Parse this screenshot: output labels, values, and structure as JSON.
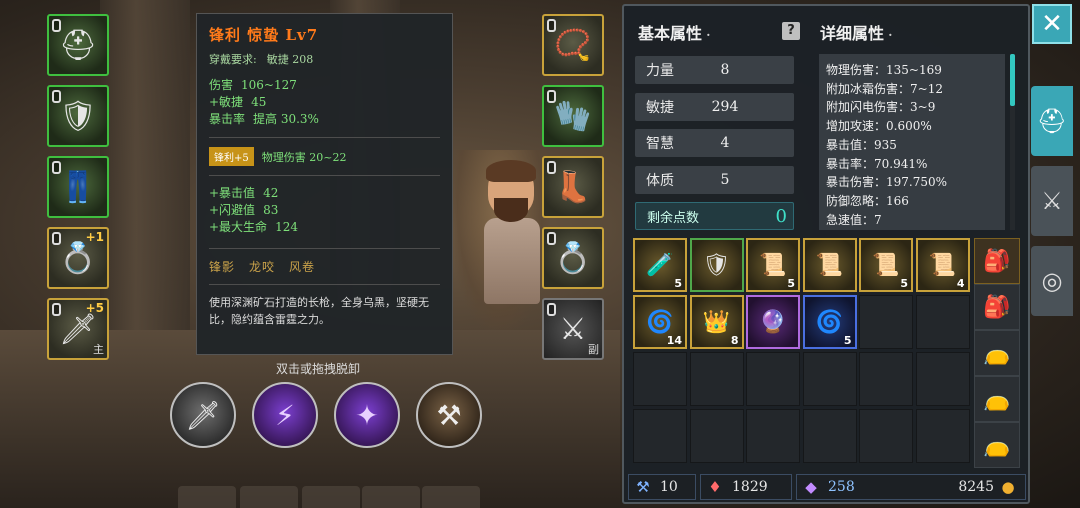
{
  "equipment_left": [
    {
      "name": "helmet",
      "border": "green",
      "icon": "helmet-icon",
      "glyph": "⛑"
    },
    {
      "name": "armor",
      "border": "green",
      "icon": "armor-icon",
      "glyph": "🛡"
    },
    {
      "name": "pants",
      "border": "green",
      "icon": "pants-icon",
      "glyph": "👖"
    },
    {
      "name": "ring",
      "border": "gold",
      "icon": "ring-icon",
      "glyph": "💍",
      "plus": "+1"
    },
    {
      "name": "spear",
      "border": "gold",
      "icon": "spear-icon",
      "glyph": "🗡",
      "plus": "+5",
      "tag": "主"
    }
  ],
  "equipment_right": [
    {
      "name": "necklace",
      "border": "gold",
      "icon": "necklace-icon",
      "glyph": "📿"
    },
    {
      "name": "gloves",
      "border": "green",
      "icon": "gloves-icon",
      "glyph": "🧤"
    },
    {
      "name": "boots",
      "border": "gold",
      "icon": "boots-icon",
      "glyph": "👢"
    },
    {
      "name": "ring2",
      "border": "gold",
      "icon": "ring-icon",
      "glyph": "💍"
    },
    {
      "name": "offhand",
      "border": "grey",
      "icon": "sword-icon",
      "glyph": "⚔",
      "tag": "副"
    }
  ],
  "tooltip": {
    "title": "锋利 惊蛰 Lv7",
    "req_label": "穿戴要求:",
    "req_value": "敏捷 208",
    "base_stats": [
      {
        "k": "伤害",
        "v": "106~127"
      },
      {
        "k": "+敏捷",
        "v": "45"
      },
      {
        "k": "暴击率",
        "v": "提高 30.3%"
      }
    ],
    "refine_badge": "锋利+5",
    "refine_text": "物理伤害 20~22",
    "extra_stats": [
      {
        "k": "+暴击值",
        "v": "42"
      },
      {
        "k": "+闪避值",
        "v": "83"
      },
      {
        "k": "+最大生命",
        "v": "124"
      }
    ],
    "sets": [
      "锋影",
      "龙咬",
      "风卷"
    ],
    "description": "使用深渊矿石打造的长枪，全身乌黑，坚硬无比，隐约蕴含雷霆之力。"
  },
  "hint": "双击或拖拽脱卸",
  "skills": [
    {
      "name": "skill-dagger",
      "icon": "dagger-skill-icon",
      "glyph": "🗡",
      "style": "grey"
    },
    {
      "name": "skill-purple-strike",
      "icon": "purple-strike-icon",
      "glyph": "⚡",
      "style": "purple"
    },
    {
      "name": "skill-purple-claw",
      "icon": "purple-claw-icon",
      "glyph": "✦",
      "style": "purple"
    },
    {
      "name": "skill-brown",
      "icon": "brown-skill-icon",
      "glyph": "⚒",
      "style": "brown"
    }
  ],
  "panel": {
    "basic_title": "基本属性",
    "detail_title": "详细属性",
    "help": "?",
    "basic": [
      {
        "k": "力量",
        "v": "8"
      },
      {
        "k": "敏捷",
        "v": "294"
      },
      {
        "k": "智慧",
        "v": "4"
      },
      {
        "k": "体质",
        "v": "5"
      }
    ],
    "remaining_label": "剩余点数",
    "remaining_value": "0",
    "details": [
      "物理伤害：135~169",
      "附加冰霜伤害：7~12",
      "附加闪电伤害：3~9",
      "增加攻速：0.600%",
      "暴击值：935",
      "暴击率：70.941%",
      "暴击伤害：197.750%",
      "防御忽略：166",
      "急速值：7"
    ]
  },
  "inventory": [
    {
      "icon": "blue-potion-icon",
      "glyph": "🧪",
      "count": "5",
      "style": "item"
    },
    {
      "icon": "green-shield-icon",
      "glyph": "🛡",
      "count": "",
      "style": "item green"
    },
    {
      "icon": "scroll-icon",
      "glyph": "📜",
      "count": "5",
      "style": "item"
    },
    {
      "icon": "scroll-icon",
      "glyph": "📜",
      "count": "",
      "style": "item"
    },
    {
      "icon": "scroll-icon",
      "glyph": "📜",
      "count": "5",
      "style": "item"
    },
    {
      "icon": "scroll-icon",
      "glyph": "📜",
      "count": "4",
      "style": "item"
    },
    {
      "icon": "spiral-icon",
      "glyph": "🌀",
      "count": "14",
      "style": "item"
    },
    {
      "icon": "gem-crown-icon",
      "glyph": "👑",
      "count": "8",
      "style": "item"
    },
    {
      "icon": "purple-staff-icon",
      "glyph": "🔮",
      "count": "",
      "style": "item purple"
    },
    {
      "icon": "blue-swirl-icon",
      "glyph": "🌀",
      "count": "5",
      "style": "item blue"
    }
  ],
  "bags": [
    {
      "icon": "backpack-icon",
      "glyph": "🎒",
      "active": true
    },
    {
      "icon": "backpack-icon",
      "glyph": "🎒",
      "active": false
    },
    {
      "icon": "pouch-icon",
      "glyph": "👝",
      "active": false
    },
    {
      "icon": "pouch-icon",
      "glyph": "👝",
      "active": false
    },
    {
      "icon": "pouch-icon",
      "glyph": "👝",
      "active": false
    }
  ],
  "currencies": {
    "c1": "10",
    "c2": "1829",
    "c3": "258",
    "c4": "8245"
  },
  "side_tabs": [
    {
      "name": "tab-equipment",
      "icon": "helmet-icon",
      "glyph": "⛑",
      "active": true
    },
    {
      "name": "tab-weapons",
      "icon": "crossed-swords-icon",
      "glyph": "⚔",
      "active": false
    },
    {
      "name": "tab-target",
      "icon": "target-icon",
      "glyph": "◎",
      "active": false
    }
  ],
  "close": "✕"
}
